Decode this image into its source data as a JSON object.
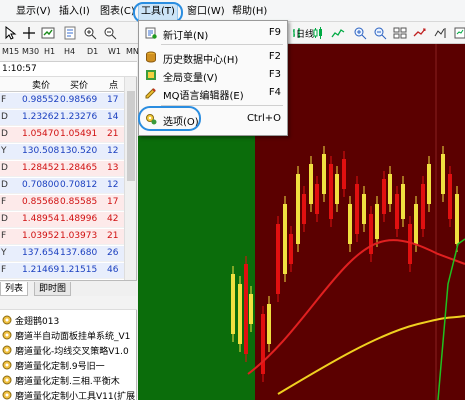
{
  "menubar": {
    "items": [
      {
        "label": "显示(V)"
      },
      {
        "label": "插入(I)"
      },
      {
        "label": "图表(C)"
      },
      {
        "label": "工具(T)"
      },
      {
        "label": "窗口(W)"
      },
      {
        "label": "帮助(H)"
      }
    ]
  },
  "toolbar": {
    "timeframes": [
      "M15",
      "M30",
      "H1",
      "H4",
      "D1",
      "W1",
      "MN"
    ],
    "chart_menu_text": "日线"
  },
  "market_watch": {
    "time": "1:10:57",
    "headers": {
      "bid": "卖价",
      "ask": "买价",
      "spread": "点"
    },
    "rows": [
      {
        "sym": "F",
        "bid": "0.98552",
        "ask": "0.98569",
        "spread": "17",
        "dir": "up"
      },
      {
        "sym": "D",
        "bid": "1.23262",
        "ask": "1.23276",
        "spread": "14",
        "dir": "up"
      },
      {
        "sym": "D",
        "bid": "1.05470",
        "ask": "1.05491",
        "spread": "21",
        "dir": "dn"
      },
      {
        "sym": "Y",
        "bid": "130.508",
        "ask": "130.520",
        "spread": "12",
        "dir": "up"
      },
      {
        "sym": "D",
        "bid": "1.28452",
        "ask": "1.28465",
        "spread": "13",
        "dir": "dn"
      },
      {
        "sym": "D",
        "bid": "0.70800",
        "ask": "0.70812",
        "spread": "12",
        "dir": "up"
      },
      {
        "sym": "F",
        "bid": "0.85568",
        "ask": "0.85585",
        "spread": "17",
        "dir": "dn"
      },
      {
        "sym": "D",
        "bid": "1.48954",
        "ask": "1.48996",
        "spread": "42",
        "dir": "dn"
      },
      {
        "sym": "F",
        "bid": "1.03952",
        "ask": "1.03973",
        "spread": "21",
        "dir": "dn"
      },
      {
        "sym": "Y",
        "bid": "137.654",
        "ask": "137.680",
        "spread": "26",
        "dir": "up"
      },
      {
        "sym": "F",
        "bid": "1.21469",
        "ask": "1.21515",
        "spread": "46",
        "dir": "up"
      }
    ]
  },
  "tabs": [
    {
      "label": "列表"
    },
    {
      "label": "即时图"
    }
  ],
  "navigator": {
    "items": [
      {
        "label": "金翅鹊013"
      },
      {
        "label": "磨道半自动面板挂单系统_V1"
      },
      {
        "label": "磨道量化-均线交叉策略V1.0"
      },
      {
        "label": "磨道量化定制.9号旧一"
      },
      {
        "label": "磨道量化定制.三相.平衡木"
      },
      {
        "label": "磨道量化定制小工具V11(扩展"
      }
    ]
  },
  "dropdown": {
    "items": [
      {
        "label": "新订单(N)",
        "key": "F9",
        "icon": "new-order-icon"
      },
      {
        "label": "历史数据中心(H)",
        "key": "F2",
        "icon": "history-center-icon"
      },
      {
        "label": "全局变量(V)",
        "key": "F3",
        "icon": "global-variables-icon"
      },
      {
        "label": "MQ语言编辑器(E)",
        "key": "F4",
        "icon": "metaeditor-icon"
      },
      {
        "label": "选项(O)",
        "key": "Ctrl+O",
        "icon": "options-icon"
      }
    ]
  },
  "colors": {
    "highlight": "#2a8de0",
    "chart_bg": "#5b0000",
    "bull_candle": "#f0e040",
    "bear_candle": "#e01010",
    "green_zone": "#0b6d0b"
  }
}
